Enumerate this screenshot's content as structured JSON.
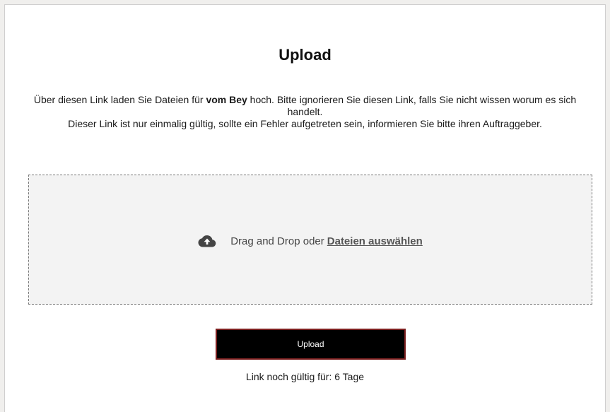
{
  "page": {
    "title": "Upload"
  },
  "description": {
    "line1_pre": "Über diesen Link laden Sie Dateien für ",
    "line1_bold": "vom Bey",
    "line1_post": " hoch. Bitte ignorieren Sie diesen Link, falls Sie nicht wissen worum es sich handelt.",
    "line2": "Dieser Link ist nur einmalig gültig, sollte ein Fehler aufgetreten sein, informieren Sie bitte ihren Auftraggeber."
  },
  "dropzone": {
    "icon": "cloud-upload-icon",
    "prefix": "Drag and Drop oder",
    "link_label": "Dateien auswählen"
  },
  "actions": {
    "upload_label": "Upload"
  },
  "validity": {
    "text": "Link noch gültig für: 6 Tage"
  },
  "colors": {
    "button_bg": "#000000",
    "button_border": "#7a1f1f",
    "dropzone_bg": "#f3f3f3"
  }
}
